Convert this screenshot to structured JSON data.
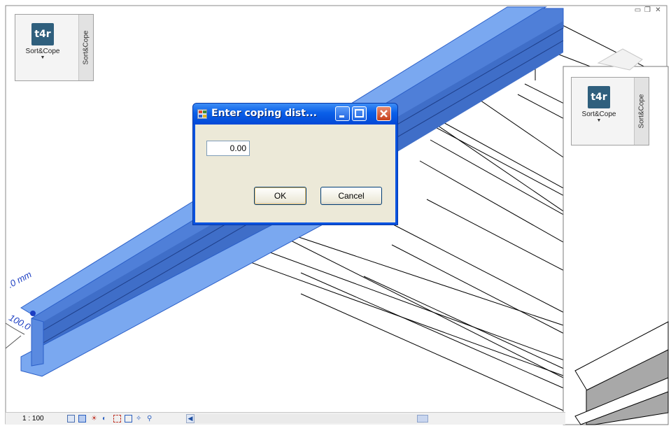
{
  "dialog": {
    "title": "Enter coping dist...",
    "value": "0.00",
    "ok_label": "OK",
    "cancel_label": "Cancel"
  },
  "ribbon_left": {
    "logo_text": "t4r",
    "button_label": "Sort&Cope",
    "panel_title": "Sort&Cope"
  },
  "ribbon_right": {
    "logo_text": "t4r",
    "button_label": "Sort&Cope",
    "panel_title": "Sort&Cope"
  },
  "dimensions": {
    "upper": ".0 mm",
    "lower": "100.0"
  },
  "statusbar": {
    "scale": "1 : 100",
    "icons": [
      "detail-level-icon",
      "visual-style-icon",
      "sun-path-icon",
      "shadows-icon",
      "crop-region-icon",
      "crop-visibility-icon",
      "temporary-hide-icon",
      "reveal-hidden-icon"
    ]
  },
  "colors": {
    "selection_blue": "#6f9ee8",
    "titlebar_blue": "#0a5fe8",
    "dialog_face": "#ece9d8"
  }
}
